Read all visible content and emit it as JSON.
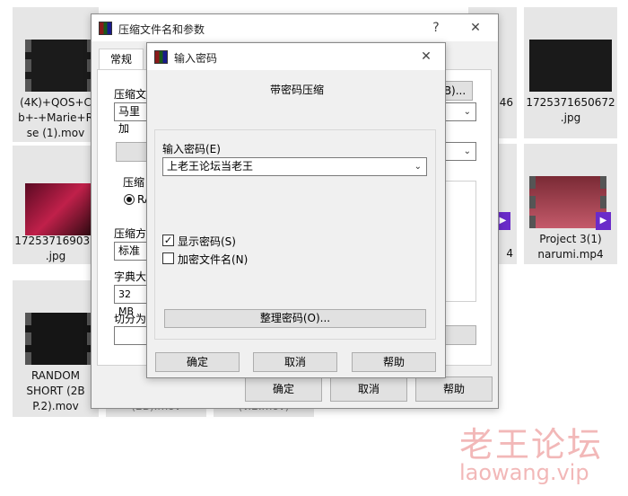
{
  "tiles": [
    {
      "caption": "(4K)+QOS+C\nb+-+Marie+R\nse (1).mov",
      "badge": "▶"
    },
    {
      "caption": "172537169032\n.jpg"
    },
    {
      "caption": "RANDOM\nSHORT (2B\nP.2).mov",
      "badge": "▶"
    },
    {
      "caption": "1725371650672\n.jpg"
    },
    {
      "caption": "Project 3(1)\nnarumi.mp4",
      "badge": "▶"
    },
    {
      "caption": "46"
    },
    {
      "caption": "4"
    }
  ],
  "back_dialog": {
    "title": "压缩文件名和参数",
    "help_glyph": "?",
    "close_glyph": "✕",
    "tab_general": "常规",
    "archive_label": "压缩文",
    "archive_value": "马里加",
    "browse_label": "B)...",
    "format_label": "压缩",
    "format_option": "RA",
    "method_label": "压缩方",
    "method_value": "标准",
    "dict_label": "字典大",
    "dict_value": "32 MB",
    "split_label": "切分为",
    "ok": "确定",
    "cancel": "取消",
    "help": "帮助",
    "partial_bottom_left": "(2B).mov",
    "partial_bottom_mid": "(v.2.mov)"
  },
  "password_dialog": {
    "title": "输入密码",
    "close_glyph": "✕",
    "heading": "带密码压缩",
    "enter_label": "输入密码(E)",
    "password_value": "上老王论坛当老王",
    "show_password": "显示密码(S)",
    "show_password_checked": true,
    "encrypt_names": "加密文件名(N)",
    "encrypt_names_checked": false,
    "organize_button": "整理密码(O)...",
    "ok": "确定",
    "cancel": "取消",
    "help": "帮助"
  },
  "watermark": {
    "line1": "老王论坛",
    "line2": "laowang.vip"
  }
}
